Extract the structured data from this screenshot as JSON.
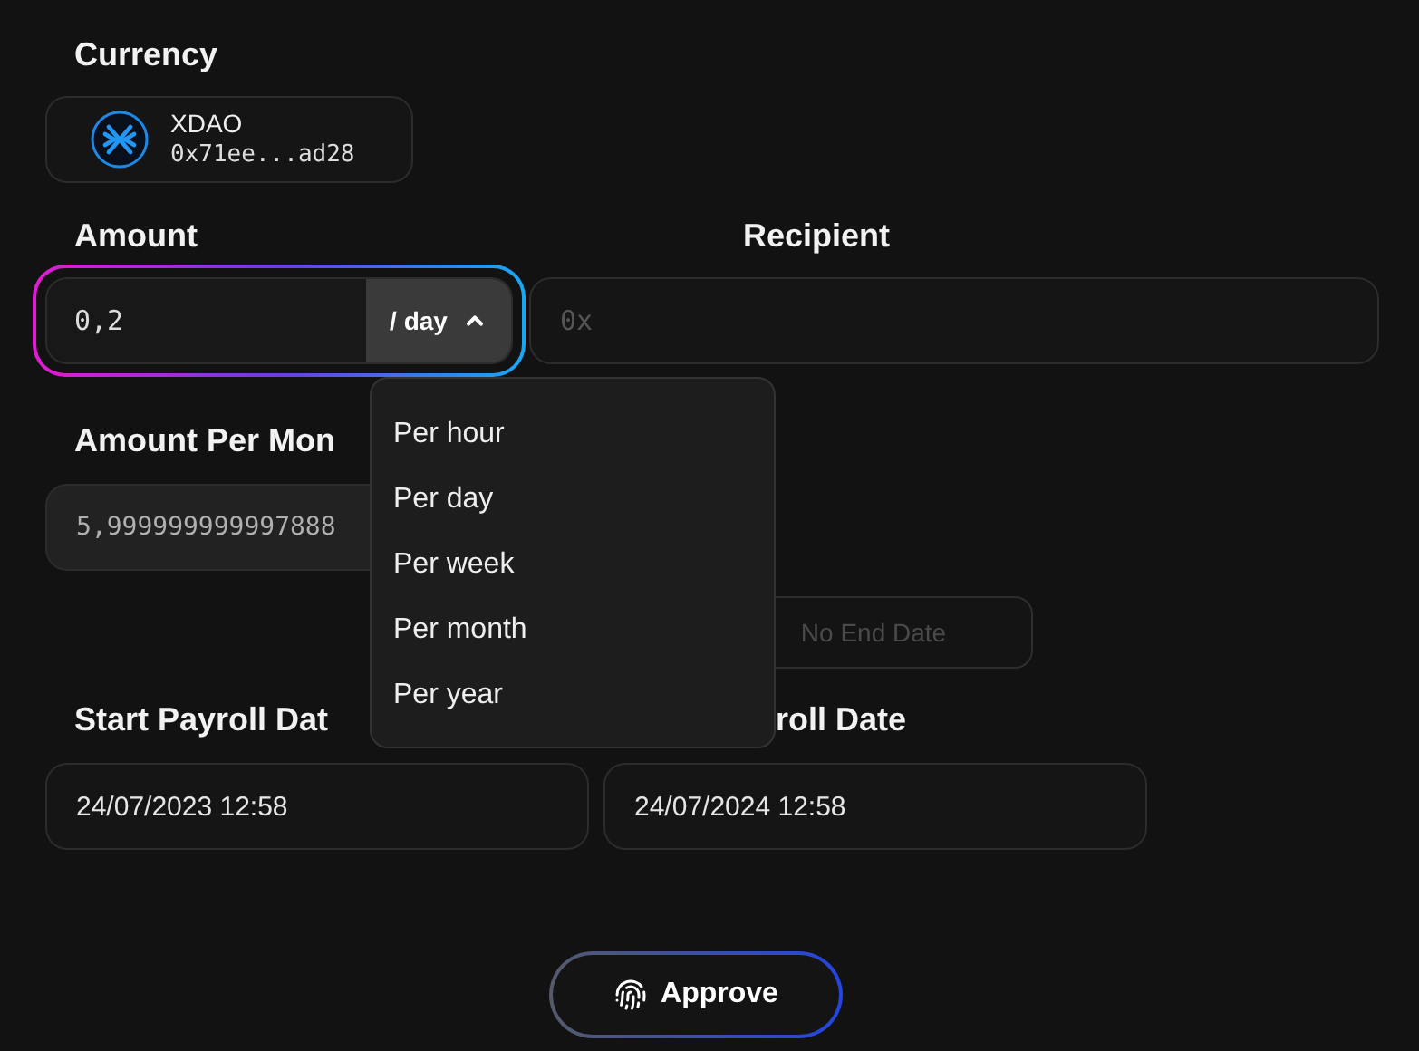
{
  "currency": {
    "label": "Currency",
    "name": "XDAO",
    "address": "0x71ee...ad28"
  },
  "amount": {
    "label": "Amount",
    "value": "0,2",
    "period": "/ day",
    "expanded": true
  },
  "period_menu": [
    {
      "label": "Per hour"
    },
    {
      "label": "Per day"
    },
    {
      "label": "Per week"
    },
    {
      "label": "Per month"
    },
    {
      "label": "Per year"
    }
  ],
  "recipient": {
    "label": "Recipient",
    "placeholder": "0x"
  },
  "amount_per_month": {
    "label": "Amount Per Mon",
    "value": "5,999999999997888"
  },
  "no_end_date_button": "No End Date",
  "start_date": {
    "label": "Start Payroll Dat",
    "value": "24/07/2023 12:58"
  },
  "end_date": {
    "label": "roll Date",
    "value": "24/07/2024 12:58"
  },
  "approve_button": "Approve"
}
